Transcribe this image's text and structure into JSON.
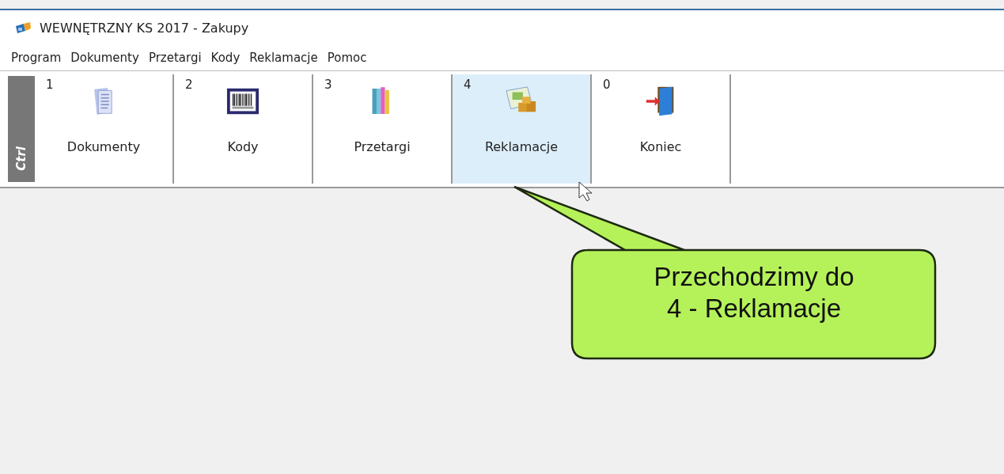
{
  "window": {
    "title": "WEWNĘTRZNY KS 2017 - Zakupy"
  },
  "menu": [
    "Program",
    "Dokumenty",
    "Przetargi",
    "Kody",
    "Reklamacje",
    "Pomoc"
  ],
  "toolbar": {
    "modifier": "Ctrl",
    "buttons": [
      {
        "key": "1",
        "label": "Dokumenty",
        "kind": "documents",
        "selected": false
      },
      {
        "key": "2",
        "label": "Kody",
        "kind": "barcode",
        "selected": false
      },
      {
        "key": "3",
        "label": "Przetargi",
        "kind": "binders",
        "selected": false
      },
      {
        "key": "4",
        "label": "Reklamacje",
        "kind": "boxes",
        "selected": true
      },
      {
        "key": "0",
        "label": "Koniec",
        "kind": "exit",
        "selected": false
      }
    ]
  },
  "callout": {
    "lines": [
      "Przechodzimy do",
      "4 - Reklamacje"
    ]
  }
}
